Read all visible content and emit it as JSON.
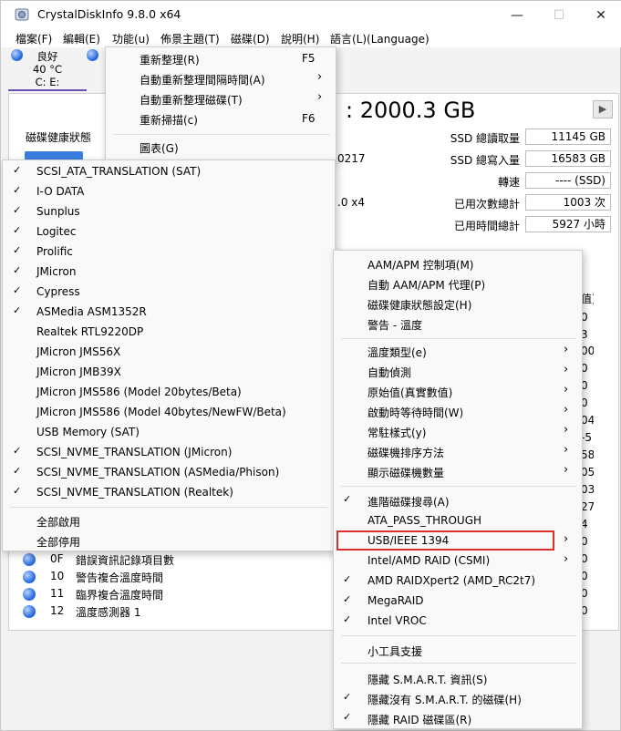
{
  "window": {
    "title": "CrystalDiskInfo 9.8.0 x64"
  },
  "menubar": [
    "檔案(F)",
    "編輯(E)",
    "功能(u)",
    "佈景主題(T)",
    "磁碟(D)",
    "說明(H)",
    "語言(L)(Language)"
  ],
  "disk_tab": {
    "status": "良好",
    "temp": "40 °C",
    "drives": "C: E:"
  },
  "disk_header": {
    "name_suffix": ": 2000.3 GB",
    "health_label": "磁碟健康狀態"
  },
  "left_values": [
    "0217",
    ".0 x4"
  ],
  "info_rows": [
    {
      "label": "SSD 總讀取量",
      "value": "11145 GB"
    },
    {
      "label": "SSD 總寫入量",
      "value": "16583 GB"
    },
    {
      "label": "轉速",
      "value": "---- (SSD)"
    },
    {
      "label": "已用次數總計",
      "value": "1003 次"
    },
    {
      "label": "已用時間總計",
      "value": "5927 小時"
    }
  ],
  "smart_rows": [
    {
      "id": "0F",
      "name": "錯誤資訊記錄項目數"
    },
    {
      "id": "10",
      "name": "警告複合溫度時間"
    },
    {
      "id": "11",
      "name": "臨界複合溫度時間"
    },
    {
      "id": "12",
      "name": "溫度感測器 1"
    }
  ],
  "right_values": [
    "值)",
    "0",
    "3",
    "00",
    "0",
    "0",
    "0",
    "04",
    "-5",
    "58",
    "05",
    "03",
    "27",
    "4",
    "0",
    "0",
    "0",
    "0",
    "0",
    "07"
  ],
  "function_menu": [
    {
      "label": "重新整理(R)",
      "accel": "F5"
    },
    {
      "label": "自動重新整理間隔時間(A)",
      "submenu": true
    },
    {
      "label": "自動重新整理磁碟(T)",
      "submenu": true
    },
    {
      "label": "重新掃描(c)",
      "accel": "F6"
    },
    {
      "label": "圖表(G)"
    }
  ],
  "usb_submenu": {
    "items": [
      {
        "label": "SCSI_ATA_TRANSLATION (SAT)",
        "checked": "✓"
      },
      {
        "label": "I-O DATA",
        "checked": "✓"
      },
      {
        "label": "Sunplus",
        "checked": "✓"
      },
      {
        "label": "Logitec",
        "checked": "✓"
      },
      {
        "label": "Prolific",
        "checked": "✓"
      },
      {
        "label": "JMicron",
        "checked": "✓"
      },
      {
        "label": "Cypress",
        "checked": "✓"
      },
      {
        "label": "ASMedia ASM1352R",
        "checked": "✓"
      },
      {
        "label": "Realtek RTL9220DP",
        "checked": ""
      },
      {
        "label": "JMicron JMS56X",
        "checked": ""
      },
      {
        "label": "JMicron JMB39X",
        "checked": ""
      },
      {
        "label": "JMicron JMS586 (Model 20bytes/Beta)",
        "checked": ""
      },
      {
        "label": "JMicron JMS586 (Model 40bytes/NewFW/Beta)",
        "checked": ""
      },
      {
        "label": "USB Memory (SAT)",
        "checked": ""
      },
      {
        "label": "SCSI_NVME_TRANSLATION (JMicron)",
        "checked": "✓"
      },
      {
        "label": "SCSI_NVME_TRANSLATION (ASMedia/Phison)",
        "checked": "✓"
      },
      {
        "label": "SCSI_NVME_TRANSLATION (Realtek)",
        "checked": "✓"
      }
    ],
    "enable_all": "全部啟用",
    "disable_all": "全部停用"
  },
  "advanced_menu": {
    "group1": [
      "AAM/APM 控制項(M)",
      "自動 AAM/APM 代理(P)",
      "磁碟健康狀態設定(H)",
      "警告 - 溫度"
    ],
    "group2": [
      "溫度類型(e)",
      "自動偵測",
      "原始值(真實數值)",
      "啟動時等待時間(W)",
      "常駐樣式(y)",
      "磁碟機排序方法",
      "顯示磁碟機數量"
    ],
    "group3": [
      {
        "label": "進階磁碟搜尋(A)",
        "checked": "✓",
        "submenu": false
      },
      {
        "label": "ATA_PASS_THROUGH",
        "checked": "",
        "submenu": false
      },
      {
        "label": "USB/IEEE 1394",
        "checked": "",
        "submenu": true
      },
      {
        "label": "Intel/AMD RAID (CSMI)",
        "checked": "",
        "submenu": true
      },
      {
        "label": "AMD RAIDXpert2 (AMD_RC2t7)",
        "checked": "✓",
        "submenu": false
      },
      {
        "label": "MegaRAID",
        "checked": "✓",
        "submenu": false
      },
      {
        "label": "Intel VROC",
        "checked": "✓",
        "submenu": false
      }
    ],
    "gadget": "小工具支援",
    "group4": [
      {
        "label": "隱藏 S.M.A.R.T. 資訊(S)",
        "checked": ""
      },
      {
        "label": "隱藏沒有 S.M.A.R.T. 的磁碟(H)",
        "checked": "✓"
      },
      {
        "label": "隱藏 RAID 磁碟區(R)",
        "checked": "✓"
      }
    ]
  }
}
